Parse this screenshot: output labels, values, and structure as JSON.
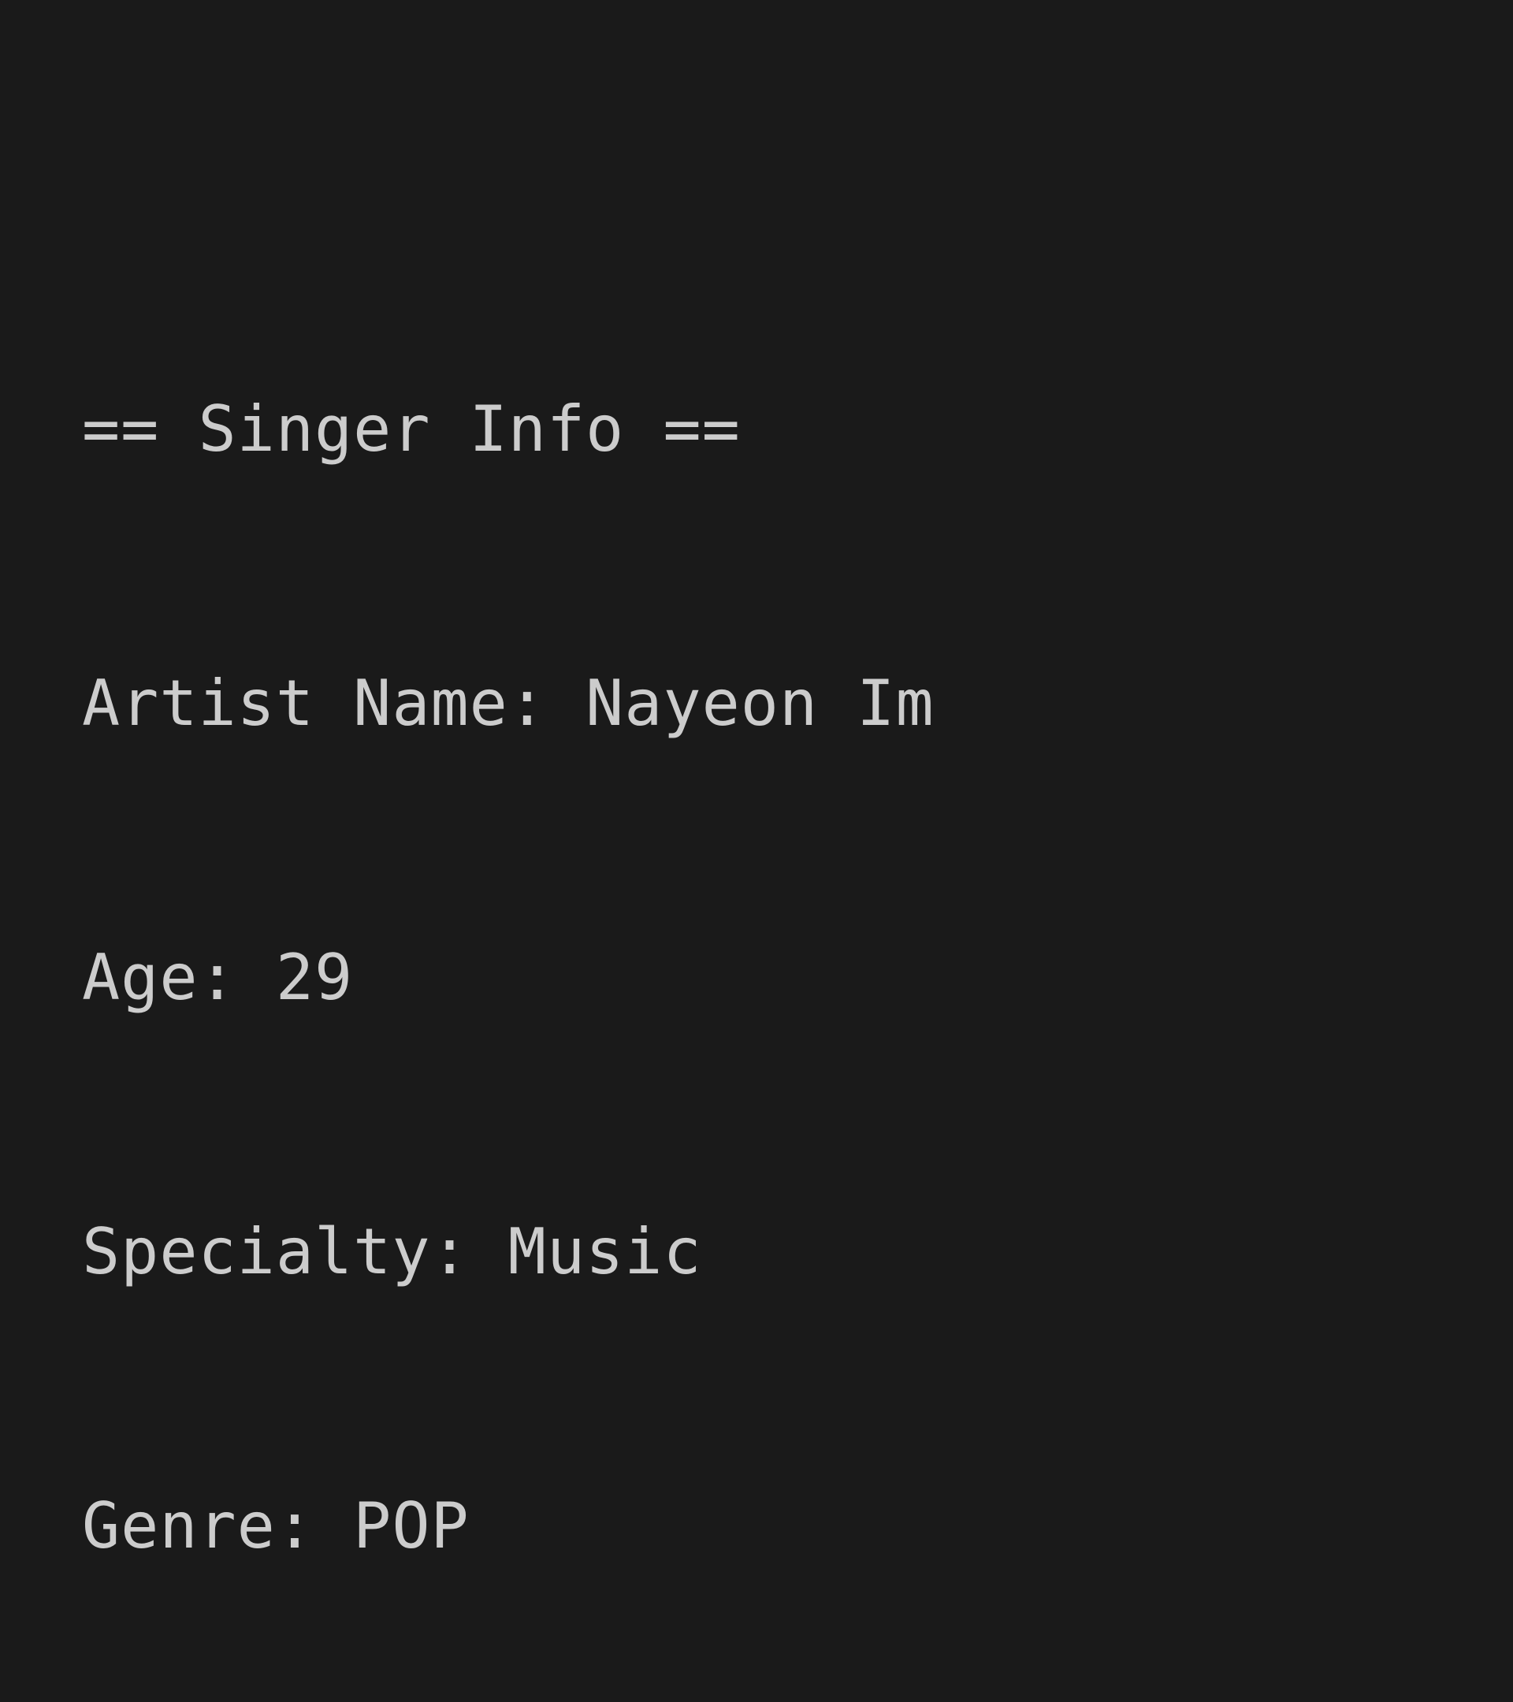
{
  "console": {
    "background": "#1a1a1a",
    "text_color": "#cccccc",
    "lines": [
      "== Singer Info ==",
      "Artist Name: Nayeon Im",
      "Age: 29",
      "Specialty: Music",
      "Genre: POP"
    ]
  }
}
